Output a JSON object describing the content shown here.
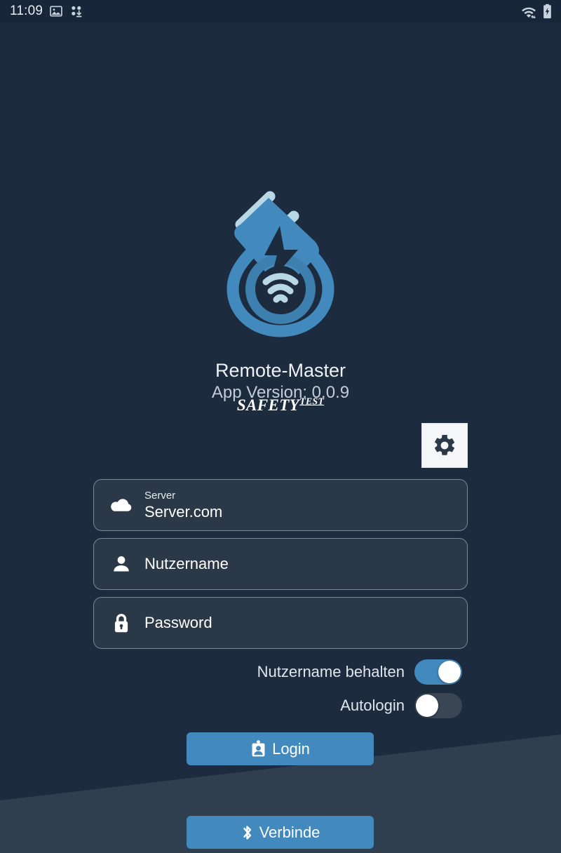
{
  "status_bar": {
    "clock": "11:09",
    "left_icons": [
      "image-icon",
      "app-download-icon"
    ],
    "right_icons": [
      "wifi-icon",
      "battery-charging-icon"
    ],
    "background_color": "#18263a"
  },
  "branding": {
    "logo_alt": "plug-wifi-droplet-logo",
    "app_title": "Remote-Master",
    "app_version": "App Version: 0.0.9",
    "company_logo_main": "SAFETY",
    "company_logo_sup": "TEST"
  },
  "settings": {
    "gear_button_name": "gear-icon",
    "gear_button_bg": "#f4f6f8"
  },
  "form": {
    "server": {
      "icon": "cloud-icon",
      "label": "Server",
      "value": "Server.com"
    },
    "username": {
      "icon": "person-icon",
      "placeholder": "Nutzername",
      "value": ""
    },
    "password": {
      "icon": "lock-icon",
      "placeholder": "Password",
      "value": ""
    }
  },
  "toggles": [
    {
      "label": "Nutzername behalten",
      "state": "on",
      "color": "#4289bd"
    },
    {
      "label": "Autologin",
      "state": "off",
      "color": "#3a4654"
    }
  ],
  "buttons": {
    "login": {
      "label": "Login",
      "icon": "id-badge-icon",
      "color": "#4289bd"
    },
    "connect": {
      "label": "Verbinde",
      "icon": "bluetooth-icon",
      "color": "#4289bd"
    }
  },
  "theme": {
    "background": "#1d2b3e",
    "diagonal_band": "#2f3f50",
    "field_fill": "#2b3847",
    "field_border": "#7b8a9b",
    "accent": "#4289bd",
    "logo_blue": "#4289bd",
    "logo_light": "#b8d8e6"
  }
}
